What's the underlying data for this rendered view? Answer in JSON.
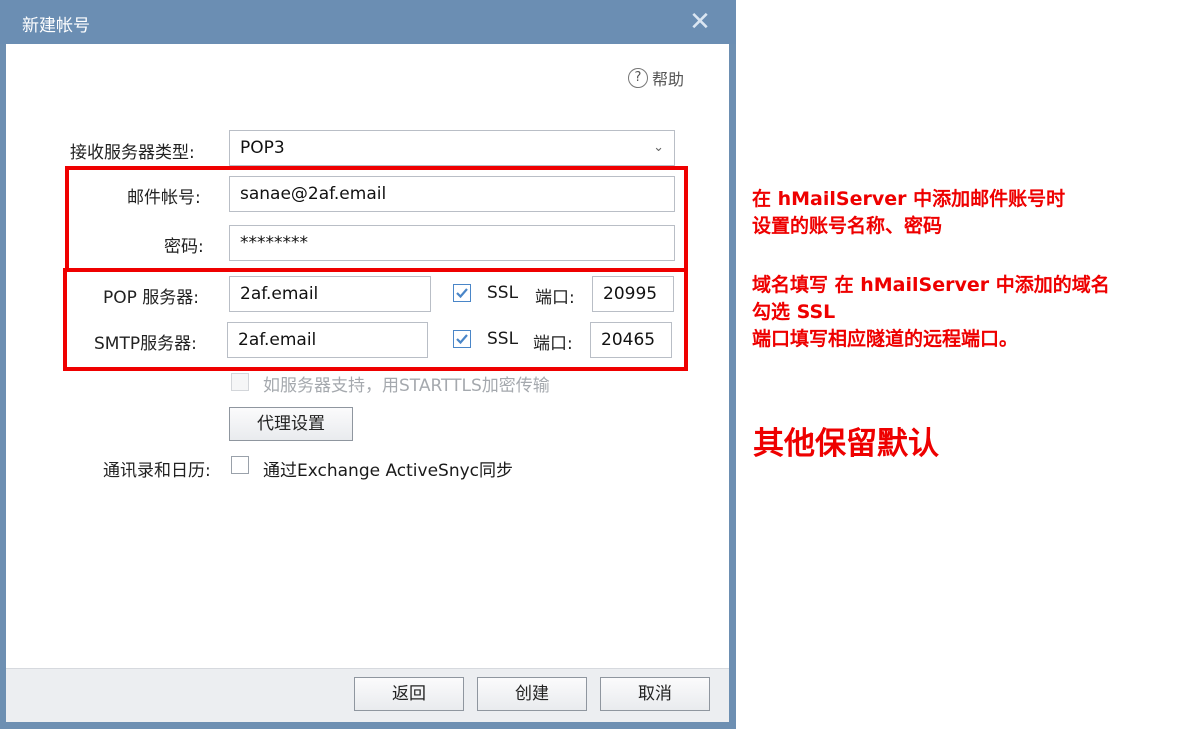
{
  "dialog": {
    "title": "新建帐号",
    "help_label": "帮助",
    "server_type_label": "接收服务器类型:",
    "server_type_value": "POP3",
    "email_label": "邮件帐号:",
    "email_value": "sanae@2af.email",
    "password_label": "密码:",
    "password_value": "********",
    "pop": {
      "label": "POP 服务器:",
      "server": "2af.email",
      "ssl_label": "SSL",
      "ssl_checked": true,
      "port_label": "端口:",
      "port": "20995"
    },
    "smtp": {
      "label": "SMTP服务器:",
      "server": "2af.email",
      "ssl_label": "SSL",
      "ssl_checked": true,
      "port_label": "端口:",
      "port": "20465"
    },
    "starttls_label": "如服务器支持，用STARTTLS加密传输",
    "proxy_button": "代理设置",
    "contacts_label": "通讯录和日历:",
    "exchange_label": "通过Exchange ActiveSnyc同步",
    "buttons": {
      "back": "返回",
      "create": "创建",
      "cancel": "取消"
    }
  },
  "annotations": {
    "note1_line1": "在 hMailServer 中添加邮件账号时",
    "note1_line2": "设置的账号名称、密码",
    "note2_line1": "域名填写 在 hMailServer 中添加的域名",
    "note2_line2": "勾选 SSL",
    "note2_line3": "端口填写相应隧道的远程端口。",
    "note3": "其他保留默认",
    "highlight_color": "#ef0000"
  },
  "colors": {
    "titlebar": "#6b8eb3",
    "accent_check": "#4a86c8"
  }
}
